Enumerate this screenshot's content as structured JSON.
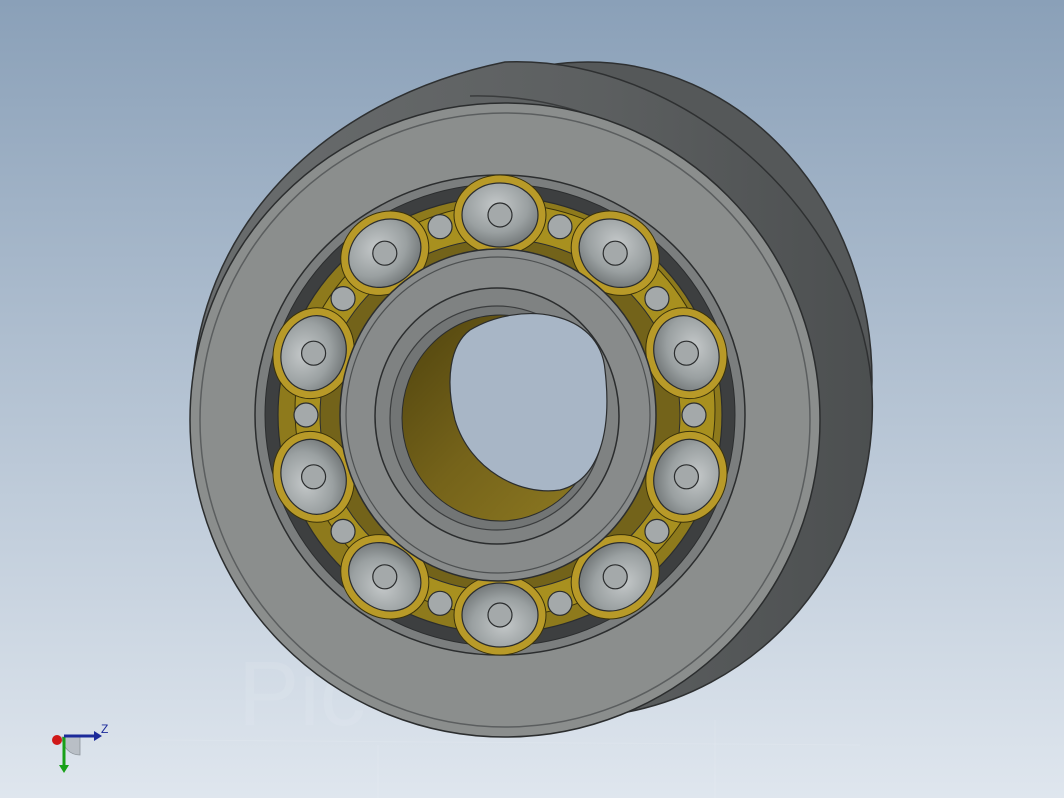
{
  "viewport": {
    "background_top": "#8aa0b8",
    "background_bottom": "#dfe6ee"
  },
  "model": {
    "name": "deep-groove-ball-bearing",
    "ball_count": 10,
    "colors": {
      "outer_ring_face": "#8b8e8d",
      "outer_ring_side": "#5e6162",
      "inner_ring": "#8c8f8e",
      "cage": "#8e7a1c",
      "cage_highlight": "#b89a28",
      "ball": "#9ea3a4",
      "bore_inside": "#6e5d14"
    }
  },
  "triad": {
    "x_color": "#d01818",
    "y_color": "#18a018",
    "z_color": "#1b2a9a",
    "z_label": "Z"
  },
  "watermark": {
    "text": "Pic"
  }
}
